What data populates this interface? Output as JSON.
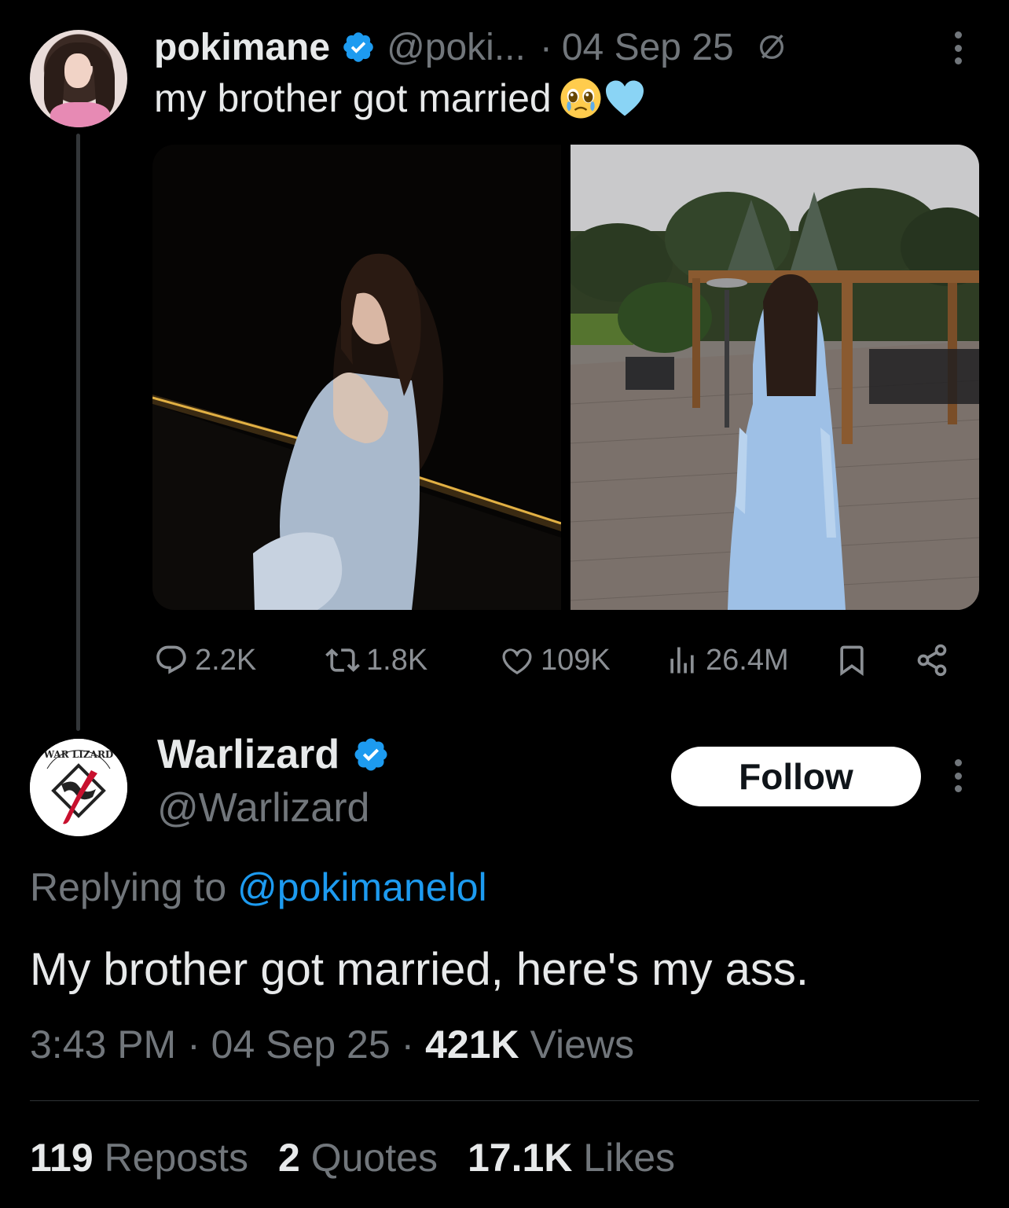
{
  "parent_tweet": {
    "author_name": "pokimane",
    "author_handle": "@poki...",
    "separator": "·",
    "date": "04 Sep 25",
    "text": "my brother got married",
    "emojis": [
      "pleading-face-emoji",
      "light-blue-heart-emoji"
    ],
    "media": [
      "photo-woman-night-balcony",
      "photo-woman-back-garden-patio"
    ],
    "actions": {
      "replies": "2.2K",
      "reposts": "1.8K",
      "likes": "109K",
      "views": "26.4M"
    }
  },
  "reply_tweet": {
    "author_name": "Warlizard",
    "author_handle": "@Warlizard",
    "follow_label": "Follow",
    "replying_prefix": "Replying to ",
    "replying_to": "@pokimanelol",
    "text": "My brother got married, here's my ass.",
    "time": "3:43 PM",
    "date": "04 Sep 25",
    "views_count": "421K",
    "views_label": "Views",
    "sep": " · ",
    "stats": {
      "reposts_count": "119",
      "reposts_label": "Reposts",
      "quotes_count": "2",
      "quotes_label": "Quotes",
      "likes_count": "17.1K",
      "likes_label": "Likes"
    },
    "avatar_text": "WAR LIZARD"
  },
  "colors": {
    "background": "#000000",
    "text_primary": "#e7e9ea",
    "text_muted": "#71767b",
    "link": "#1d9bf0",
    "verified": "#1d9bf0"
  }
}
